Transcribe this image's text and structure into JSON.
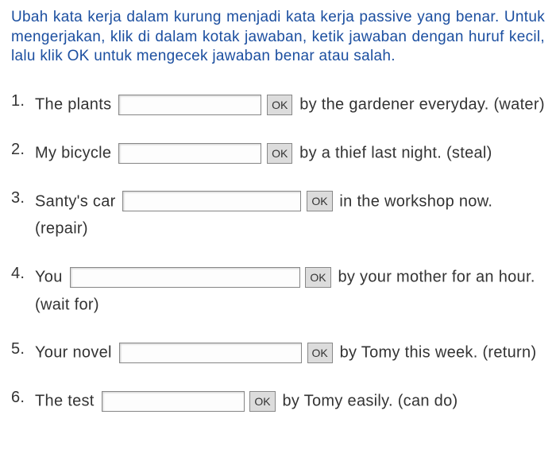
{
  "instructions": "Ubah kata kerja dalam kurung menjadi kata kerja passive yang benar. Untuk mengerjakan, klik di dalam kotak jawaban, ketik jawaban dengan huruf kecil, lalu klik OK untuk mengecek jawaban benar atau salah.",
  "ok_label": "OK",
  "items": [
    {
      "num": "1.",
      "before": "The plants",
      "after": "by the gardener everyday.",
      "hint": "(water)",
      "input_class": "w1"
    },
    {
      "num": "2.",
      "before": "My bicycle",
      "after": "by a thief last night.",
      "hint": "(steal)",
      "input_class": "w2"
    },
    {
      "num": "3.",
      "before": "Santy's car",
      "after": "in the workshop now.",
      "hint": "(repair)",
      "input_class": "w3"
    },
    {
      "num": "4.",
      "before": "You",
      "after": "by your mother for an hour.",
      "hint": "(wait for)",
      "input_class": "w4"
    },
    {
      "num": "5.",
      "before": "Your novel",
      "after": "by Tomy this week.",
      "hint": "(return)",
      "input_class": "w5"
    },
    {
      "num": "6.",
      "before": "The test",
      "after": "by Tomy easily.",
      "hint": "(can do)",
      "input_class": "w6"
    }
  ]
}
